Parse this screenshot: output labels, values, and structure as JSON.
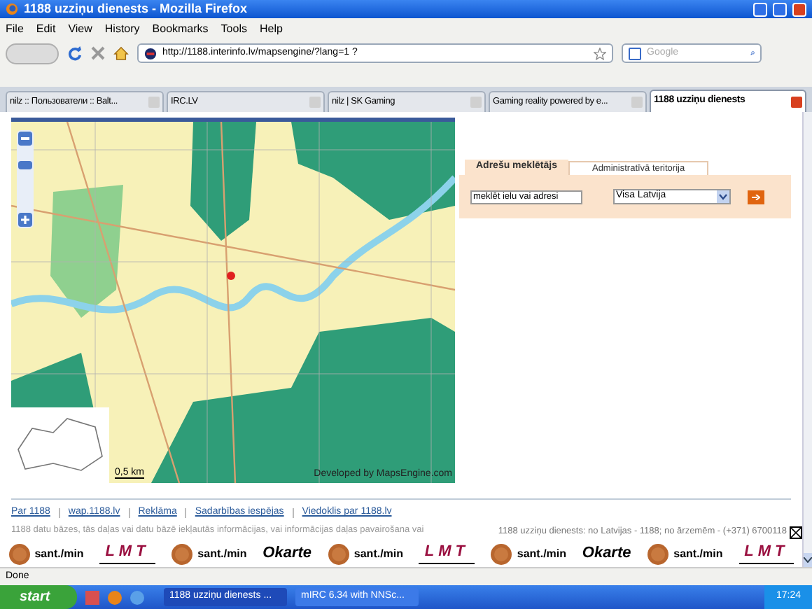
{
  "window": {
    "title": "1188 uzziņu dienests - Mozilla Firefox"
  },
  "menu": [
    "File",
    "Edit",
    "View",
    "History",
    "Bookmarks",
    "Tools",
    "Help"
  ],
  "toolbar": {
    "url": "http://1188.interinfo.lv/mapsengine/?lang=1 ?",
    "search_placeholder": "Google"
  },
  "tabs": [
    {
      "label": "nilz :: Пользователи :: Balt...",
      "selected": false
    },
    {
      "label": "IRC.LV",
      "selected": false
    },
    {
      "label": "nilz | SK Gaming",
      "selected": false
    },
    {
      "label": "Gaming reality powered by e...",
      "selected": false
    },
    {
      "label": "1188 uzziņu dienests",
      "selected": true
    }
  ],
  "map": {
    "zoom": {
      "level": 0.65
    },
    "scale": "0,5 km",
    "credit": "Developed by MapsEngine.com"
  },
  "search_panel": {
    "tabs": [
      {
        "label": "Adrešu meklētājs",
        "selected": true
      },
      {
        "label": "Administratīvā teritorija",
        "selected": false
      }
    ],
    "address_value": "meklēt ielu vai adresi",
    "region": "Visa Latvija"
  },
  "footer_links": [
    "Par 1188",
    "wap.1188.lv",
    "Reklāma",
    "Sadarbības iespējas",
    "Viedoklis par 1188.lv"
  ],
  "disclaimer": "1188 datu bāzes, tās daļas vai datu bāzē iekļautās informācijas, vai informācijas daļas pavairošana vai",
  "contact": "1188 uzziņu dienests: no Latvijas - 1188; no ārzemēm - (+371) 6700118",
  "ads": [
    {
      "kind": "rate",
      "text": "sant./min"
    },
    {
      "kind": "lmt",
      "text": "LMT"
    },
    {
      "kind": "rate",
      "text": "sant./min"
    },
    {
      "kind": "okarte",
      "text": "Okarte"
    },
    {
      "kind": "rate",
      "text": "sant./min"
    },
    {
      "kind": "lmt",
      "text": "LMT"
    },
    {
      "kind": "rate",
      "text": "sant./min"
    },
    {
      "kind": "okarte",
      "text": "Okarte"
    },
    {
      "kind": "rate",
      "text": "sant./min"
    },
    {
      "kind": "lmt",
      "text": "LMT"
    }
  ],
  "status_bar": "Done",
  "taskbar": {
    "start": "start",
    "tasks": [
      {
        "label": "1188 uzziņu dienests ...",
        "selected": true
      },
      {
        "label": "mIRC 6.34 with NNSc...",
        "selected": false
      }
    ],
    "clock": "17:24"
  }
}
